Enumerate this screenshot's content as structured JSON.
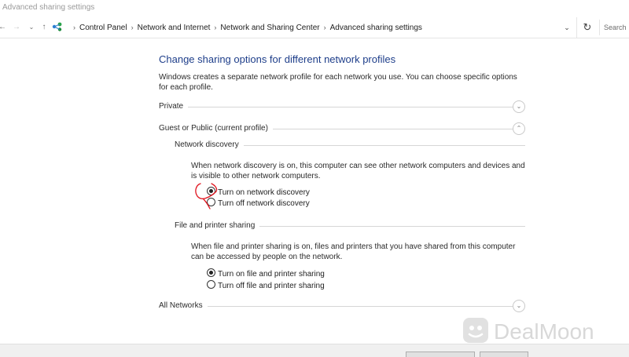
{
  "window": {
    "title": "Advanced sharing settings"
  },
  "addressbar": {
    "back_icon": "back-arrow-icon",
    "forward_icon": "forward-arrow-icon",
    "recent_icon": "chevron-down-icon",
    "up_icon": "up-arrow-icon",
    "location_icon": "network-icon",
    "breadcrumbs": [
      "Control Panel",
      "Network and Internet",
      "Network and Sharing Center",
      "Advanced sharing settings"
    ],
    "search_placeholder": "Search"
  },
  "main": {
    "title": "Change sharing options for different network profiles",
    "intro": "Windows creates a separate network profile for each network you use. You can choose specific options for each profile.",
    "profiles": {
      "private": {
        "label": "Private",
        "state": "collapsed"
      },
      "guest": {
        "label": "Guest or Public (current profile)",
        "state": "expanded"
      },
      "all": {
        "label": "All Networks",
        "state": "collapsed"
      }
    },
    "network_discovery": {
      "heading": "Network discovery",
      "description": "When network discovery is on, this computer can see other network computers and devices and is visible to other network computers.",
      "on_label": "Turn on network discovery",
      "off_label": "Turn off network discovery",
      "selected": "on"
    },
    "file_sharing": {
      "heading": "File and printer sharing",
      "description": "When file and printer sharing is on, files and printers that you have shared from this computer can be accessed by people on the network.",
      "on_label": "Turn on file and printer sharing",
      "off_label": "Turn off file and printer sharing",
      "selected": "on"
    }
  },
  "watermark": {
    "text": "DealMoon"
  },
  "colors": {
    "title_blue": "#1e3e8a",
    "annotation_red": "#e0141e"
  }
}
